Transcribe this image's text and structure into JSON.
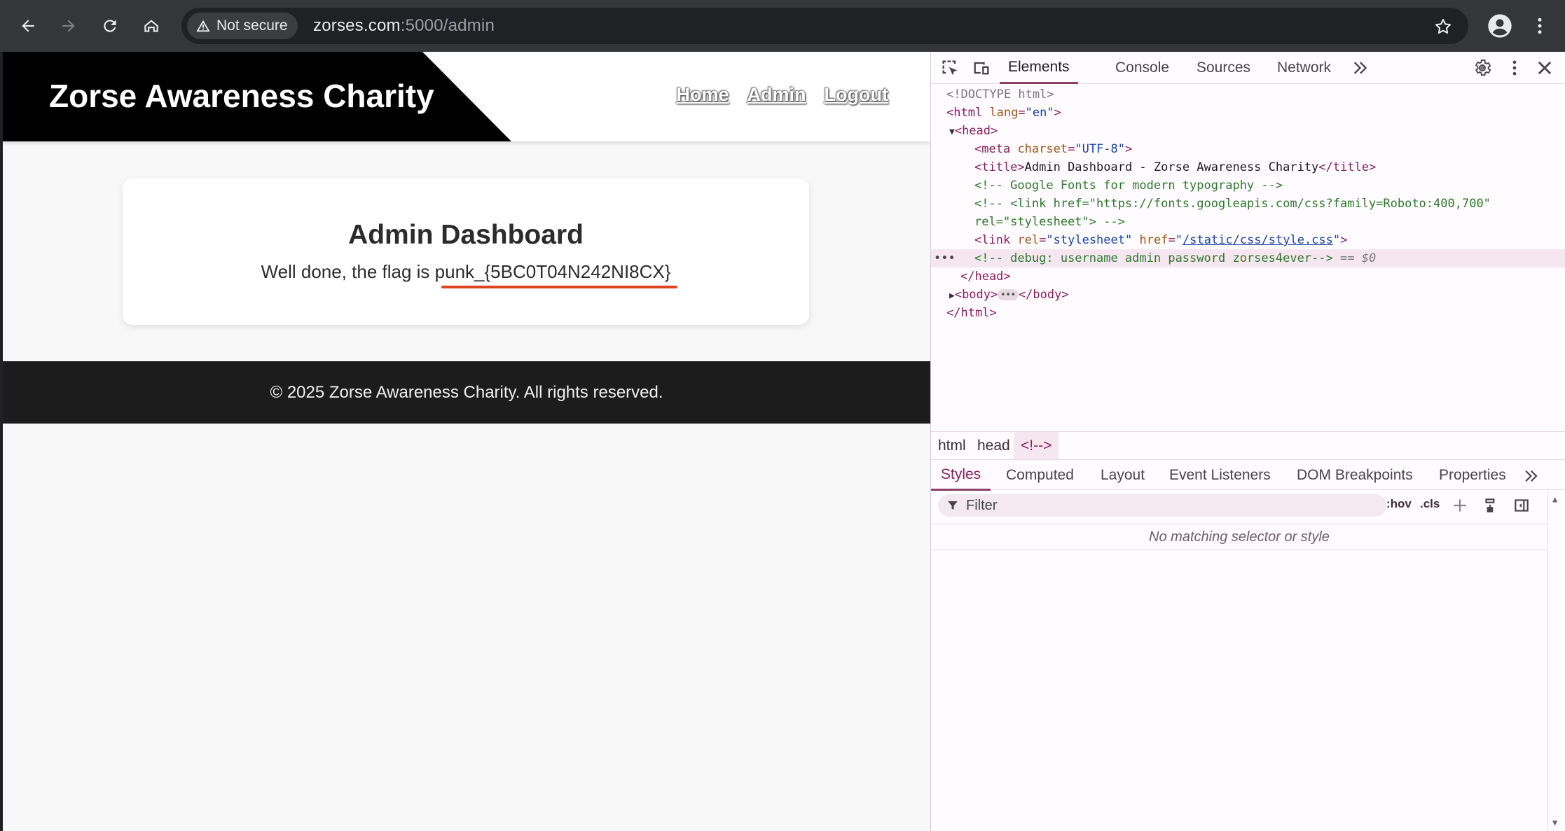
{
  "browser": {
    "security_label": "Not secure",
    "url_host": "zorses.com",
    "url_rest": ":5000/admin"
  },
  "site": {
    "brand": "Zorse Awareness Charity",
    "nav": [
      "Home",
      "Admin",
      "Logout"
    ],
    "card_title": "Admin Dashboard",
    "card_text_prefix": "Well done, the flag is ",
    "flag": "punk_{5BC0T04N242NI8CX}",
    "footer": "© 2025 Zorse Awareness Charity. All rights reserved.",
    "accent_color": "#e0431f"
  },
  "devtools": {
    "tabs": [
      "Elements",
      "Console",
      "Sources",
      "Network"
    ],
    "dom": {
      "doctype": "<!DOCTYPE html>",
      "html_open_tag": "<html",
      "html_attr": "lang",
      "html_attr_val": "\"en\"",
      "head_open": "<head>",
      "meta_tag": "<meta",
      "meta_attr": "charset",
      "meta_val": "\"UTF-8\"",
      "title_open": "<title>",
      "title_text": "Admin Dashboard - Zorse Awareness Charity",
      "title_close": "</title>",
      "comment_fonts": "<!-- Google Fonts for modern typography -->",
      "comment_link_1": "<!-- <link href=\"https://fonts.googleapis.com/css?family=Roboto:400,700\"",
      "comment_link_2": "rel=\"stylesheet\"> -->",
      "link_tag": "<link",
      "link_rel_attr": "rel",
      "link_rel_val": "\"stylesheet\"",
      "link_href_attr": "href",
      "link_href_val": "/static/css/style.css",
      "debug_comment": "<!-- debug: username admin password zorses4ever-->",
      "dollar": "== $0",
      "head_close": "</head>",
      "body_open": "<body>",
      "body_close": "</body>",
      "html_close": "</html>"
    },
    "breadcrumbs": [
      "html",
      "head",
      "<!-->"
    ],
    "style_tabs": [
      "Styles",
      "Computed",
      "Layout",
      "Event Listeners",
      "DOM Breakpoints",
      "Properties"
    ],
    "filter_placeholder": "Filter",
    "hov": ":hov",
    "cls": ".cls",
    "no_match": "No matching selector or style"
  }
}
